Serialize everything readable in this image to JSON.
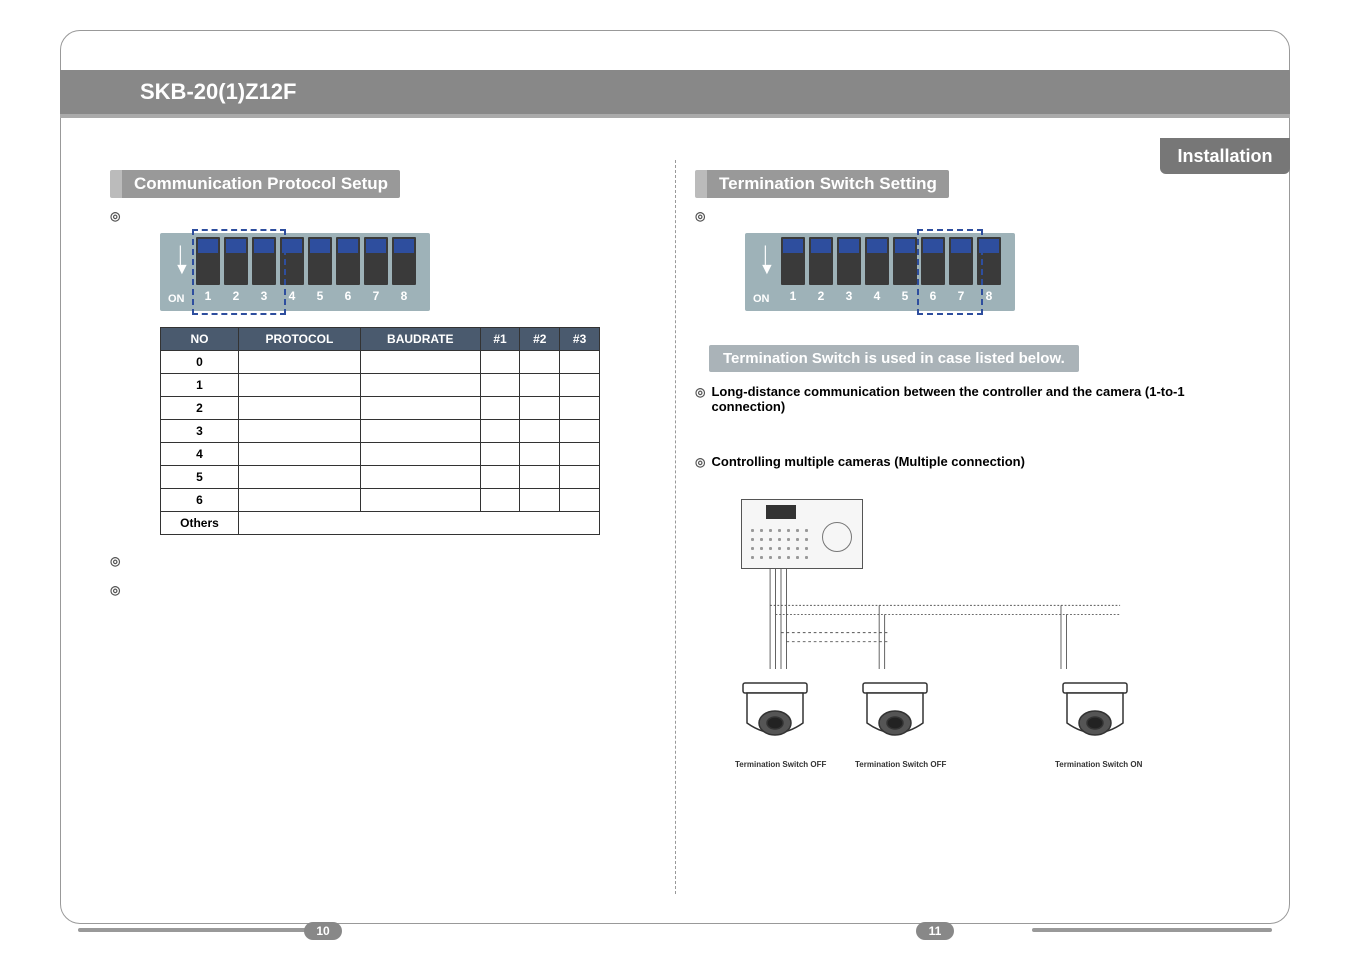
{
  "header": {
    "model": "SKB-20(1)Z12F",
    "chapter": "Installation"
  },
  "left": {
    "section_title": "Communication Protocol Setup",
    "page_number": "10",
    "dip_highlight_range": [
      1,
      3
    ],
    "table": {
      "headers": [
        "NO",
        "PROTOCOL",
        "BAUDRATE",
        "#1",
        "#2",
        "#3"
      ],
      "rows": [
        [
          "0",
          "",
          "",
          "",
          "",
          ""
        ],
        [
          "1",
          "",
          "",
          "",
          "",
          ""
        ],
        [
          "2",
          "",
          "",
          "",
          "",
          ""
        ],
        [
          "3",
          "",
          "",
          "",
          "",
          ""
        ],
        [
          "4",
          "",
          "",
          "",
          "",
          ""
        ],
        [
          "5",
          "",
          "",
          "",
          "",
          ""
        ],
        [
          "6",
          "",
          "",
          "",
          "",
          ""
        ]
      ],
      "others_label": "Others"
    }
  },
  "right": {
    "section_title": "Termination Switch Setting",
    "page_number": "11",
    "dip_highlight_range": [
      6,
      7
    ],
    "sub_banner": "Termination Switch is used in case listed below.",
    "case1": "Long-distance communication between the controller and the camera (1-to-1 connection)",
    "case2": "Controlling multiple cameras (Multiple connection)",
    "diagram_labels": {
      "cam1": "Termination Switch OFF",
      "cam2": "Termination Switch OFF",
      "cam3": "Termination Switch ON"
    }
  },
  "dip_numbers": [
    "1",
    "2",
    "3",
    "4",
    "5",
    "6",
    "7",
    "8"
  ],
  "dip_on_label": "ON"
}
